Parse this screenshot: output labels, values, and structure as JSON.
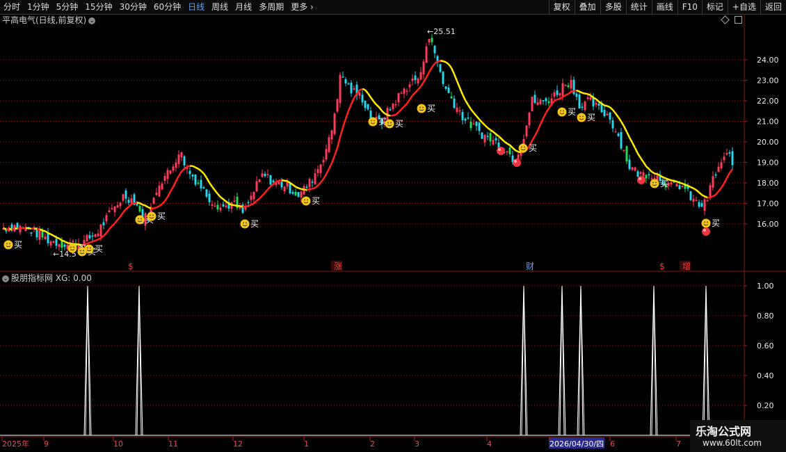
{
  "toolbar": {
    "tabs": [
      {
        "label": "分时",
        "active": false
      },
      {
        "label": "1分钟",
        "active": false
      },
      {
        "label": "5分钟",
        "active": false
      },
      {
        "label": "15分钟",
        "active": false
      },
      {
        "label": "30分钟",
        "active": false
      },
      {
        "label": "60分钟",
        "active": false
      },
      {
        "label": "日线",
        "active": true
      },
      {
        "label": "周线",
        "active": false
      },
      {
        "label": "月线",
        "active": false
      },
      {
        "label": "多周期",
        "active": false
      },
      {
        "label": "更多",
        "active": false
      }
    ],
    "right_buttons": [
      "复权",
      "叠加",
      "多股",
      "统计",
      "画线",
      "F10",
      "标记",
      "+自选",
      "返回"
    ]
  },
  "main_chart": {
    "title": "平高电气(日线,前复权)",
    "high_label": "←25.51",
    "low_label": "←14.5",
    "y_ticks": [
      "24.00",
      "23.00",
      "22.00",
      "21.00",
      "20.00",
      "19.00",
      "18.00",
      "17.00",
      "16.00"
    ],
    "buy_label": "买",
    "event_markers": [
      "$",
      "涨",
      "财",
      "$",
      "增"
    ]
  },
  "indicator": {
    "title": "股朋指标网",
    "value_label": "XG: 0.00",
    "y_ticks": [
      "1.00",
      "0.80",
      "0.60",
      "0.40",
      "0.20"
    ]
  },
  "date_axis": {
    "labels": [
      "2025年",
      "9",
      "10",
      "11",
      "12",
      "1",
      "2",
      "3",
      "4",
      "2026/04/30/四",
      "6",
      "7"
    ]
  },
  "watermark": {
    "title": "乐淘公式网",
    "url": "www.60lt.com"
  },
  "colors": {
    "up": "#ff3b5c",
    "down": "#29d6ea",
    "down_alt": "#22dd55",
    "ma_up": "#ff2020",
    "ma_down": "#ffee00",
    "grid": "#8a1a1a",
    "tab_active": "#5aa0ff"
  },
  "chart_data": {
    "type": "candlestick",
    "axes_price_range": [
      14.5,
      25.51
    ],
    "buy_signal_count": 14,
    "indicator_series": {
      "name": "XG",
      "type": "spike",
      "ylim": [
        0,
        1
      ],
      "spike_value": 1.0
    }
  }
}
